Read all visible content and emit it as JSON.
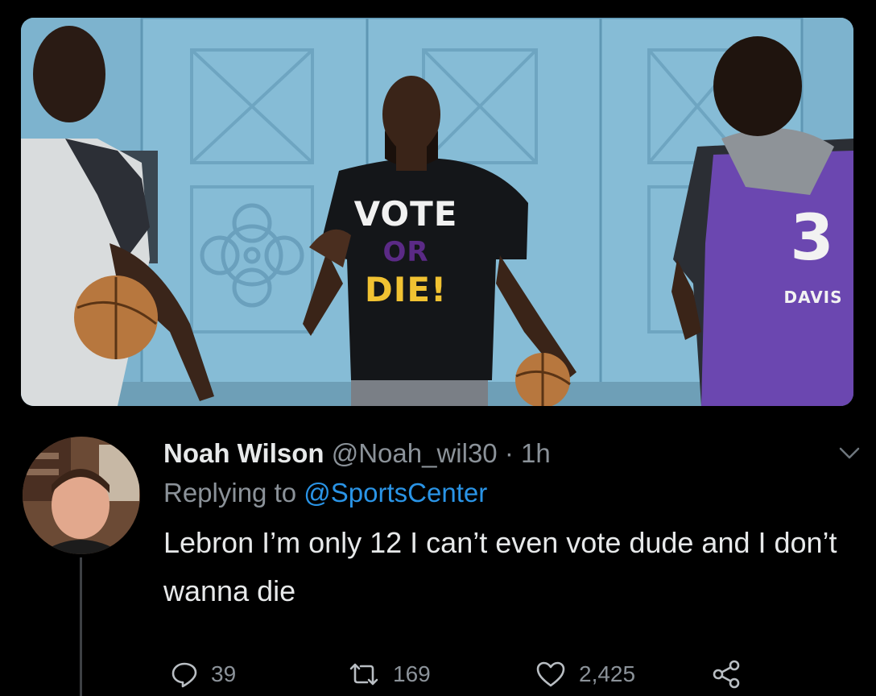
{
  "photo": {
    "shirt_text": {
      "line1": "VOTE",
      "line2": "OR",
      "line3": "DIE!"
    },
    "jersey_number": "3",
    "jersey_name": "DAVIS"
  },
  "tweet": {
    "author_name": "Noah Wilson",
    "author_meta": "@Noah_wil30 · 1h",
    "replying_prefix": "Replying to",
    "replying_handle": "@SportsCenter",
    "text": "Lebron I’m only 12 I can’t even vote dude and I don’t wanna die",
    "actions": {
      "reply_count": "39",
      "retweet_count": "169",
      "like_count": "2,425"
    }
  },
  "icons": {
    "reply": "reply-icon",
    "retweet": "retweet-icon",
    "like": "heart-icon",
    "share": "share-icon",
    "menu": "chevron-down-icon"
  },
  "colors": {
    "background": "#000000",
    "text": "#e7e9ea",
    "muted": "#8b9299",
    "link": "#2a94e6"
  }
}
